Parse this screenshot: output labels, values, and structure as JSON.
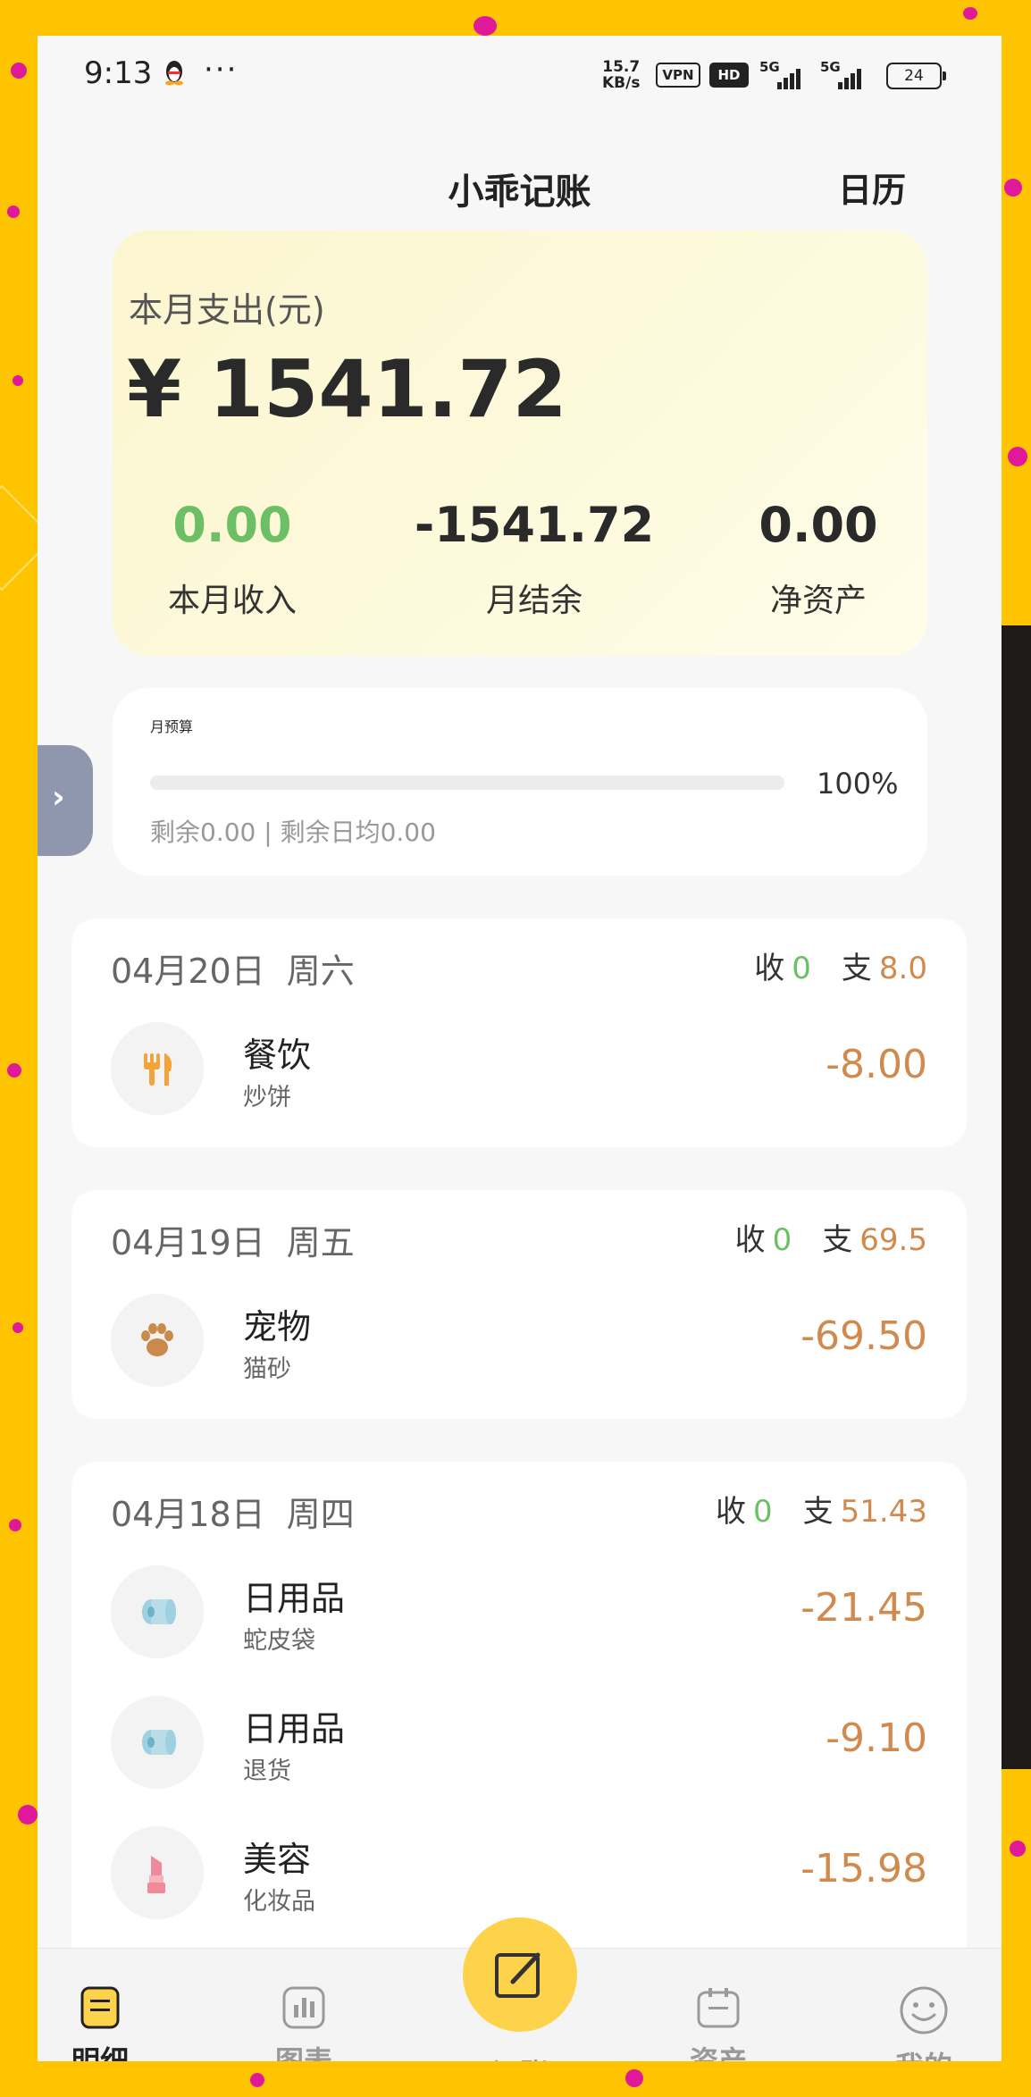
{
  "status_bar": {
    "time": "9:13",
    "more": "···",
    "speed_value": "15.7",
    "speed_unit": "KB/s",
    "vpn": "VPN",
    "hd": "HD",
    "net1": "5G",
    "net2": "5G",
    "battery": "24"
  },
  "header": {
    "title": "小乖记账",
    "calendar": "日历"
  },
  "summary": {
    "label": "本月支出(元)",
    "amount": "¥ 1541.72",
    "income_value": "0.00",
    "income_label": "本月收入",
    "balance_value": "-1541.72",
    "balance_label": "月结余",
    "net_value": "0.00",
    "net_label": "净资产"
  },
  "budget": {
    "title": "月预算",
    "percent": "100%",
    "progress_fraction": 1.0,
    "remaining": "剩余0.00 | 剩余日均0.00"
  },
  "days": [
    {
      "date": "04月20日",
      "weekday": "周六",
      "income_label": "收",
      "income": "0",
      "expense_label": "支",
      "expense": "8.0",
      "entries": [
        {
          "category": "餐饮",
          "note": "炒饼",
          "amount": "-8.00",
          "icon": "fork-knife-icon"
        }
      ]
    },
    {
      "date": "04月19日",
      "weekday": "周五",
      "income_label": "收",
      "income": "0",
      "expense_label": "支",
      "expense": "69.5",
      "entries": [
        {
          "category": "宠物",
          "note": "猫砂",
          "amount": "-69.50",
          "icon": "paw-icon"
        }
      ]
    },
    {
      "date": "04月18日",
      "weekday": "周四",
      "income_label": "收",
      "income": "0",
      "expense_label": "支",
      "expense": "51.43",
      "entries": [
        {
          "category": "日用品",
          "note": "蛇皮袋",
          "amount": "-21.45",
          "icon": "tissue-roll-icon"
        },
        {
          "category": "日用品",
          "note": "退货",
          "amount": "-9.10",
          "icon": "tissue-roll-icon"
        },
        {
          "category": "美容",
          "note": "化妆品",
          "amount": "-15.98",
          "icon": "lipstick-icon"
        }
      ]
    }
  ],
  "nav": {
    "details": "明细",
    "charts": "图表",
    "record": "记账",
    "assets": "资产",
    "mine": "我的"
  },
  "colors": {
    "background": "#ffc400",
    "income_green": "#6cbf64",
    "expense_orange": "#d08a4e",
    "record_button": "#fdd34c"
  }
}
